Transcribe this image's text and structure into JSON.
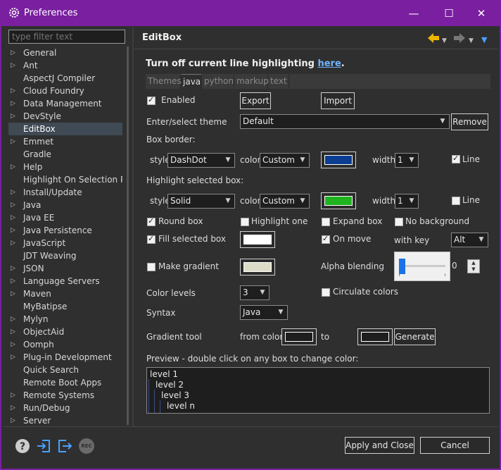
{
  "window": {
    "title": "Preferences",
    "minimize": "—",
    "maximize": "☐",
    "close": "✕",
    "accent": "#7a1fa0"
  },
  "left_panel": {
    "filter_placeholder": "type filter text",
    "tree": [
      {
        "label": "General",
        "expandable": true
      },
      {
        "label": "Ant",
        "expandable": true
      },
      {
        "label": "AspectJ Compiler",
        "expandable": false
      },
      {
        "label": "Cloud Foundry",
        "expandable": true
      },
      {
        "label": "Data Management",
        "expandable": true
      },
      {
        "label": "DevStyle",
        "expandable": true
      },
      {
        "label": "EditBox",
        "expandable": false,
        "selected": true
      },
      {
        "label": "Emmet",
        "expandable": true
      },
      {
        "label": "Gradle",
        "expandable": false
      },
      {
        "label": "Help",
        "expandable": true
      },
      {
        "label": "Highlight On Selection Pr",
        "expandable": false
      },
      {
        "label": "Install/Update",
        "expandable": true
      },
      {
        "label": "Java",
        "expandable": true
      },
      {
        "label": "Java EE",
        "expandable": true
      },
      {
        "label": "Java Persistence",
        "expandable": true
      },
      {
        "label": "JavaScript",
        "expandable": true
      },
      {
        "label": "JDT Weaving",
        "expandable": false
      },
      {
        "label": "JSON",
        "expandable": true
      },
      {
        "label": "Language Servers",
        "expandable": true
      },
      {
        "label": "Maven",
        "expandable": true
      },
      {
        "label": "MyBatipse",
        "expandable": false
      },
      {
        "label": "Mylyn",
        "expandable": true
      },
      {
        "label": "ObjectAid",
        "expandable": true
      },
      {
        "label": "Oomph",
        "expandable": true
      },
      {
        "label": "Plug-in Development",
        "expandable": true
      },
      {
        "label": "Quick Search",
        "expandable": false
      },
      {
        "label": "Remote Boot Apps",
        "expandable": false
      },
      {
        "label": "Remote Systems",
        "expandable": true
      },
      {
        "label": "Run/Debug",
        "expandable": true
      },
      {
        "label": "Server",
        "expandable": true
      }
    ]
  },
  "header": {
    "title": "EditBox",
    "back_color": "#f0b400",
    "menu_color": "#4aa0ff"
  },
  "editbox": {
    "notice_prefix": "Turn off current line highlighting ",
    "notice_link": "here",
    "notice_suffix": ".",
    "tabs": [
      "Themes",
      "java",
      "python",
      "markup",
      "text"
    ],
    "active_tab": "java",
    "enabled_label": "Enabled",
    "enabled": true,
    "export_label": "Export",
    "import_label": "Import",
    "theme_label": "Enter/select theme",
    "theme_value": "Default",
    "remove_label": "Remove",
    "box_border_label": "Box border:",
    "style_label": "style",
    "color_label": "color",
    "width_label": "width",
    "line_label": "Line",
    "border_style": "DashDot",
    "border_color": "Custom",
    "border_swatch": "#0b3d91",
    "border_width": "1",
    "border_line": true,
    "highlight_label": "Highlight selected box:",
    "hl_style": "Solid",
    "hl_color": "Custom",
    "hl_swatch": "#1fb31f",
    "hl_width": "1",
    "hl_line": false,
    "round_box_label": "Round box",
    "round_box": true,
    "highlight_one_label": "Highlight one",
    "highlight_one": false,
    "expand_box_label": "Expand box",
    "expand_box": false,
    "no_background_label": "No background",
    "no_background": false,
    "fill_selected_label": "Fill selected box",
    "fill_selected": true,
    "fill_swatch": "#ffffff",
    "on_move_label": "On move",
    "on_move": true,
    "with_key_label": "with key",
    "with_key_value": "Alt",
    "make_gradient_label": "Make gradient",
    "make_gradient": false,
    "gradient_swatch": "#dcdcc8",
    "alpha_label": "Alpha blending",
    "alpha_value": "0",
    "alpha_level": 0,
    "color_levels_label": "Color levels",
    "color_levels_value": "3",
    "circulate_label": "Circulate colors",
    "circulate": false,
    "syntax_label": "Syntax",
    "syntax_value": "Java",
    "gradient_tool_label": "Gradient tool",
    "from_color_label": "from color",
    "to_label": "to",
    "generate_label": "Generate",
    "preview_label": "Preview - double click on any box to change color:",
    "preview_levels": [
      "level 1",
      "level 2",
      "level 3",
      "level n"
    ]
  },
  "footer": {
    "help_icon_color": "#cccccc",
    "import_icon_color": "#4aa0ff",
    "rec_label": "REC",
    "apply_close_label": "Apply and Close",
    "cancel_label": "Cancel"
  }
}
